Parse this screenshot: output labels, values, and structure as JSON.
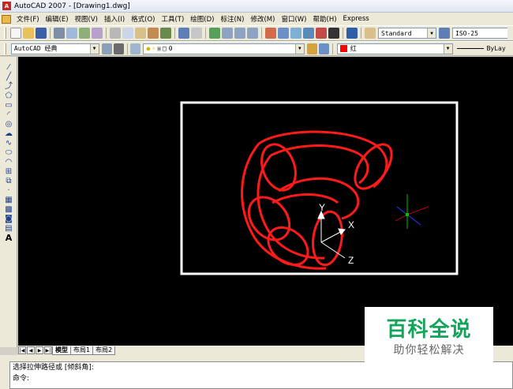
{
  "window": {
    "title": "AutoCAD 2007 - [Drawing1.dwg]"
  },
  "menubar": {
    "items": [
      "文件(F)",
      "编辑(E)",
      "视图(V)",
      "插入(I)",
      "格式(O)",
      "工具(T)",
      "绘图(D)",
      "标注(N)",
      "修改(M)",
      "窗口(W)",
      "帮助(H)",
      "Express"
    ]
  },
  "toolbar1": {
    "text_style": "Standard",
    "dim_style": "ISO-25"
  },
  "toolbar2": {
    "workspace": "AutoCAD 经典",
    "layer": "0",
    "color": "红",
    "linetype": "ByLay"
  },
  "left_toolbar": {
    "icons": [
      "line-icon",
      "construction-line-icon",
      "polyline-icon",
      "polygon-icon",
      "rectangle-icon",
      "arc-icon",
      "circle-icon",
      "revision-cloud-icon",
      "spline-icon",
      "ellipse-icon",
      "ellipse-arc-icon",
      "insert-block-icon",
      "make-block-icon",
      "point-icon",
      "hatch-icon",
      "gradient-icon",
      "region-icon",
      "table-icon",
      "multiline-text-icon"
    ],
    "text_tool": "A"
  },
  "ucs": {
    "x": "X",
    "y": "Y",
    "z": "Z"
  },
  "layout_tabs": [
    "模型",
    "布局1",
    "布局2"
  ],
  "command": {
    "prompt": "选择拉伸路径或 [倾斜角]:",
    "label": "命令:"
  },
  "watermark": {
    "title": "百科全说",
    "subtitle": "助你轻松解决"
  },
  "colors": {
    "canvas": "#000000",
    "accent_red": "#ff0000",
    "watermark_green": "#11a45a"
  }
}
